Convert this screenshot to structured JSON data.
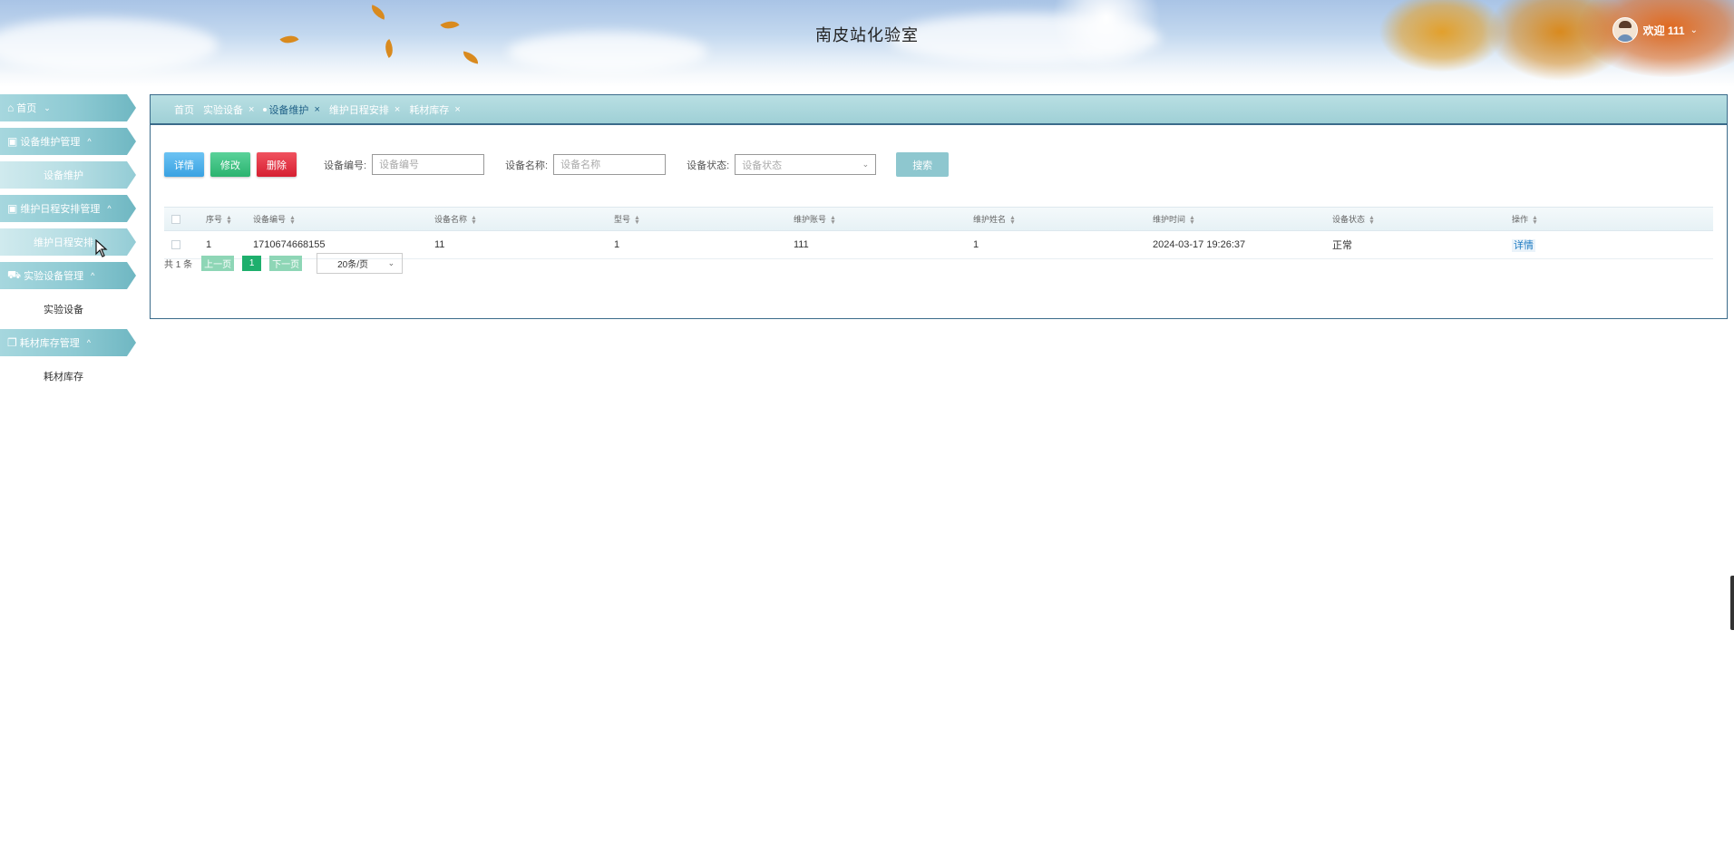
{
  "header": {
    "title": "南皮站化验室",
    "welcome_text": "欢迎 111",
    "caret": "⌄"
  },
  "sidebar": {
    "groups": [
      {
        "label": "首页",
        "icon": "home-icon",
        "glyph": "⌂",
        "chevron": "⌄",
        "items": []
      },
      {
        "label": "设备维护管理",
        "icon": "apps-icon",
        "glyph": "▣",
        "chevron": "^",
        "items": [
          {
            "label": "设备维护"
          }
        ]
      },
      {
        "label": "维护日程安排管理",
        "icon": "apps-icon",
        "glyph": "▣",
        "chevron": "^",
        "items": [
          {
            "label": "维护日程安排"
          }
        ]
      },
      {
        "label": "实验设备管理",
        "icon": "car-icon",
        "glyph": "⛟",
        "chevron": "^",
        "items": [
          {
            "label": "实验设备"
          }
        ]
      },
      {
        "label": "耗材库存管理",
        "icon": "copy-icon",
        "glyph": "❐",
        "chevron": "^",
        "items": [
          {
            "label": "耗材库存"
          }
        ]
      }
    ]
  },
  "tabs": [
    {
      "label": "首页",
      "closable": false
    },
    {
      "label": "实验设备",
      "closable": true
    },
    {
      "label": "设备维护",
      "closable": true,
      "active": true
    },
    {
      "label": "维护日程安排",
      "closable": true
    },
    {
      "label": "耗材库存",
      "closable": true
    }
  ],
  "tab_close_glyph": "×",
  "toolbar": {
    "detail_label": "详情",
    "edit_label": "修改",
    "delete_label": "删除",
    "search_label": "搜索",
    "fields": {
      "device_no": {
        "label": "设备编号:",
        "placeholder": "设备编号",
        "value": ""
      },
      "device_name": {
        "label": "设备名称:",
        "placeholder": "设备名称",
        "value": ""
      },
      "device_status": {
        "label": "设备状态:",
        "placeholder": "设备状态"
      }
    }
  },
  "table": {
    "columns": [
      "序号",
      "设备编号",
      "设备名称",
      "型号",
      "维护账号",
      "维护姓名",
      "维护时间",
      "设备状态",
      "操作"
    ],
    "rows": [
      {
        "cells": [
          "1",
          "1710674668155",
          "11",
          "1",
          "111",
          "1",
          "2024-03-17 19:26:37",
          "正常"
        ],
        "action": "详情"
      }
    ]
  },
  "pagination": {
    "total_text": "共 1 条",
    "prev_label": "上一页",
    "current_page": "1",
    "next_label": "下一页",
    "page_size": "20条/页"
  },
  "colors": {
    "accent": "#3b6b8a",
    "sidebar": "#8ecad3",
    "detail": "#3aa2e2",
    "edit": "#2bb36f",
    "delete": "#d61f31",
    "pager_active": "#1eaf6d"
  }
}
